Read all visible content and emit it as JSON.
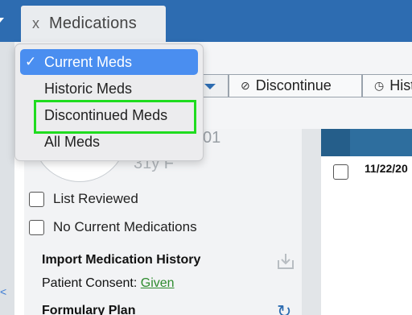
{
  "tab": {
    "close_glyph": "x",
    "title": "Medications"
  },
  "toolbar": {
    "discontinue_label": "Discontinue",
    "history_label": "Hist"
  },
  "filter_menu": {
    "items": [
      {
        "label": "Current Meds",
        "selected": true,
        "check": "✓"
      },
      {
        "label": "Historic Meds",
        "selected": false
      },
      {
        "label": "Discontinued Meds",
        "selected": false,
        "highlighted": true
      },
      {
        "label": "All Meds",
        "selected": false
      }
    ]
  },
  "patient": {
    "id_fragment": "01",
    "age_sex": "31y F"
  },
  "checks": {
    "list_reviewed": "List Reviewed",
    "no_current": "No Current Medications"
  },
  "import": {
    "title": "Import Medication History",
    "consent_label": "Patient Consent:",
    "consent_value": "Given"
  },
  "formulary": {
    "title": "Formulary Plan"
  },
  "grid": {
    "row_date": "11/22/20"
  },
  "colors": {
    "topbar": "#2d6cb1",
    "menu_selected": "#4a8ef0",
    "highlight": "#1fdc1f",
    "consent_link": "#2e8b2e"
  },
  "icons": [
    "chevron-down-icon",
    "discontinue-icon",
    "history-icon",
    "import-icon",
    "refresh-icon",
    "checkmark-icon"
  ]
}
